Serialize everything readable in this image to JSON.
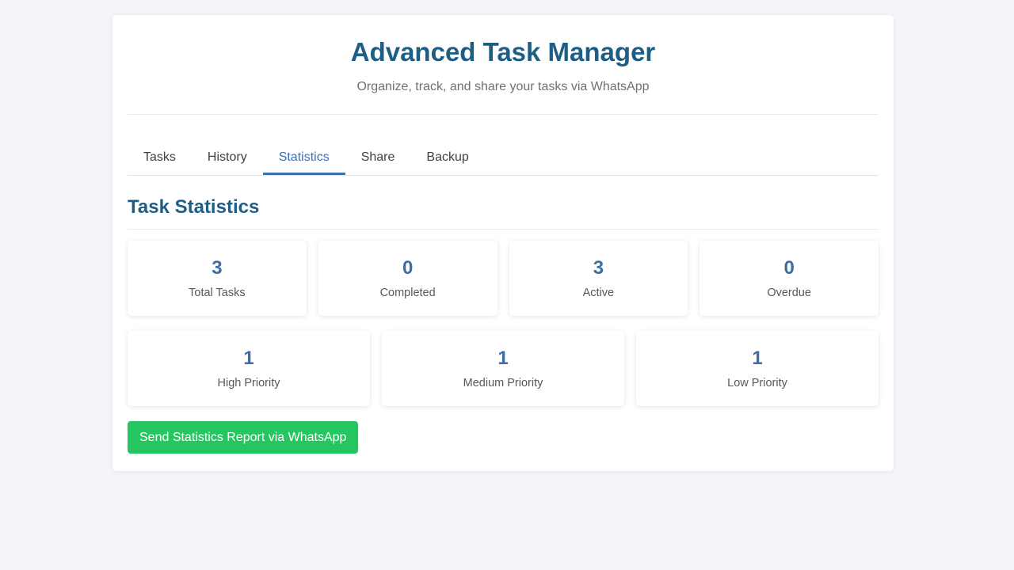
{
  "app": {
    "title": "Advanced Task Manager",
    "subtitle": "Organize, track, and share your tasks via WhatsApp"
  },
  "tabs": [
    {
      "label": "Tasks",
      "active": false
    },
    {
      "label": "History",
      "active": false
    },
    {
      "label": "Statistics",
      "active": true
    },
    {
      "label": "Share",
      "active": false
    },
    {
      "label": "Backup",
      "active": false
    }
  ],
  "statistics": {
    "heading": "Task Statistics",
    "summary": [
      {
        "value": "3",
        "label": "Total Tasks"
      },
      {
        "value": "0",
        "label": "Completed"
      },
      {
        "value": "3",
        "label": "Active"
      },
      {
        "value": "0",
        "label": "Overdue"
      }
    ],
    "priority": [
      {
        "value": "1",
        "label": "High Priority"
      },
      {
        "value": "1",
        "label": "Medium Priority"
      },
      {
        "value": "1",
        "label": "Low Priority"
      }
    ],
    "send_button_label": "Send Statistics Report via WhatsApp"
  },
  "colors": {
    "accent": "#3d70b2",
    "title": "#1e5d84",
    "whatsapp_green": "#25c660",
    "background": "#f3f5f9"
  }
}
